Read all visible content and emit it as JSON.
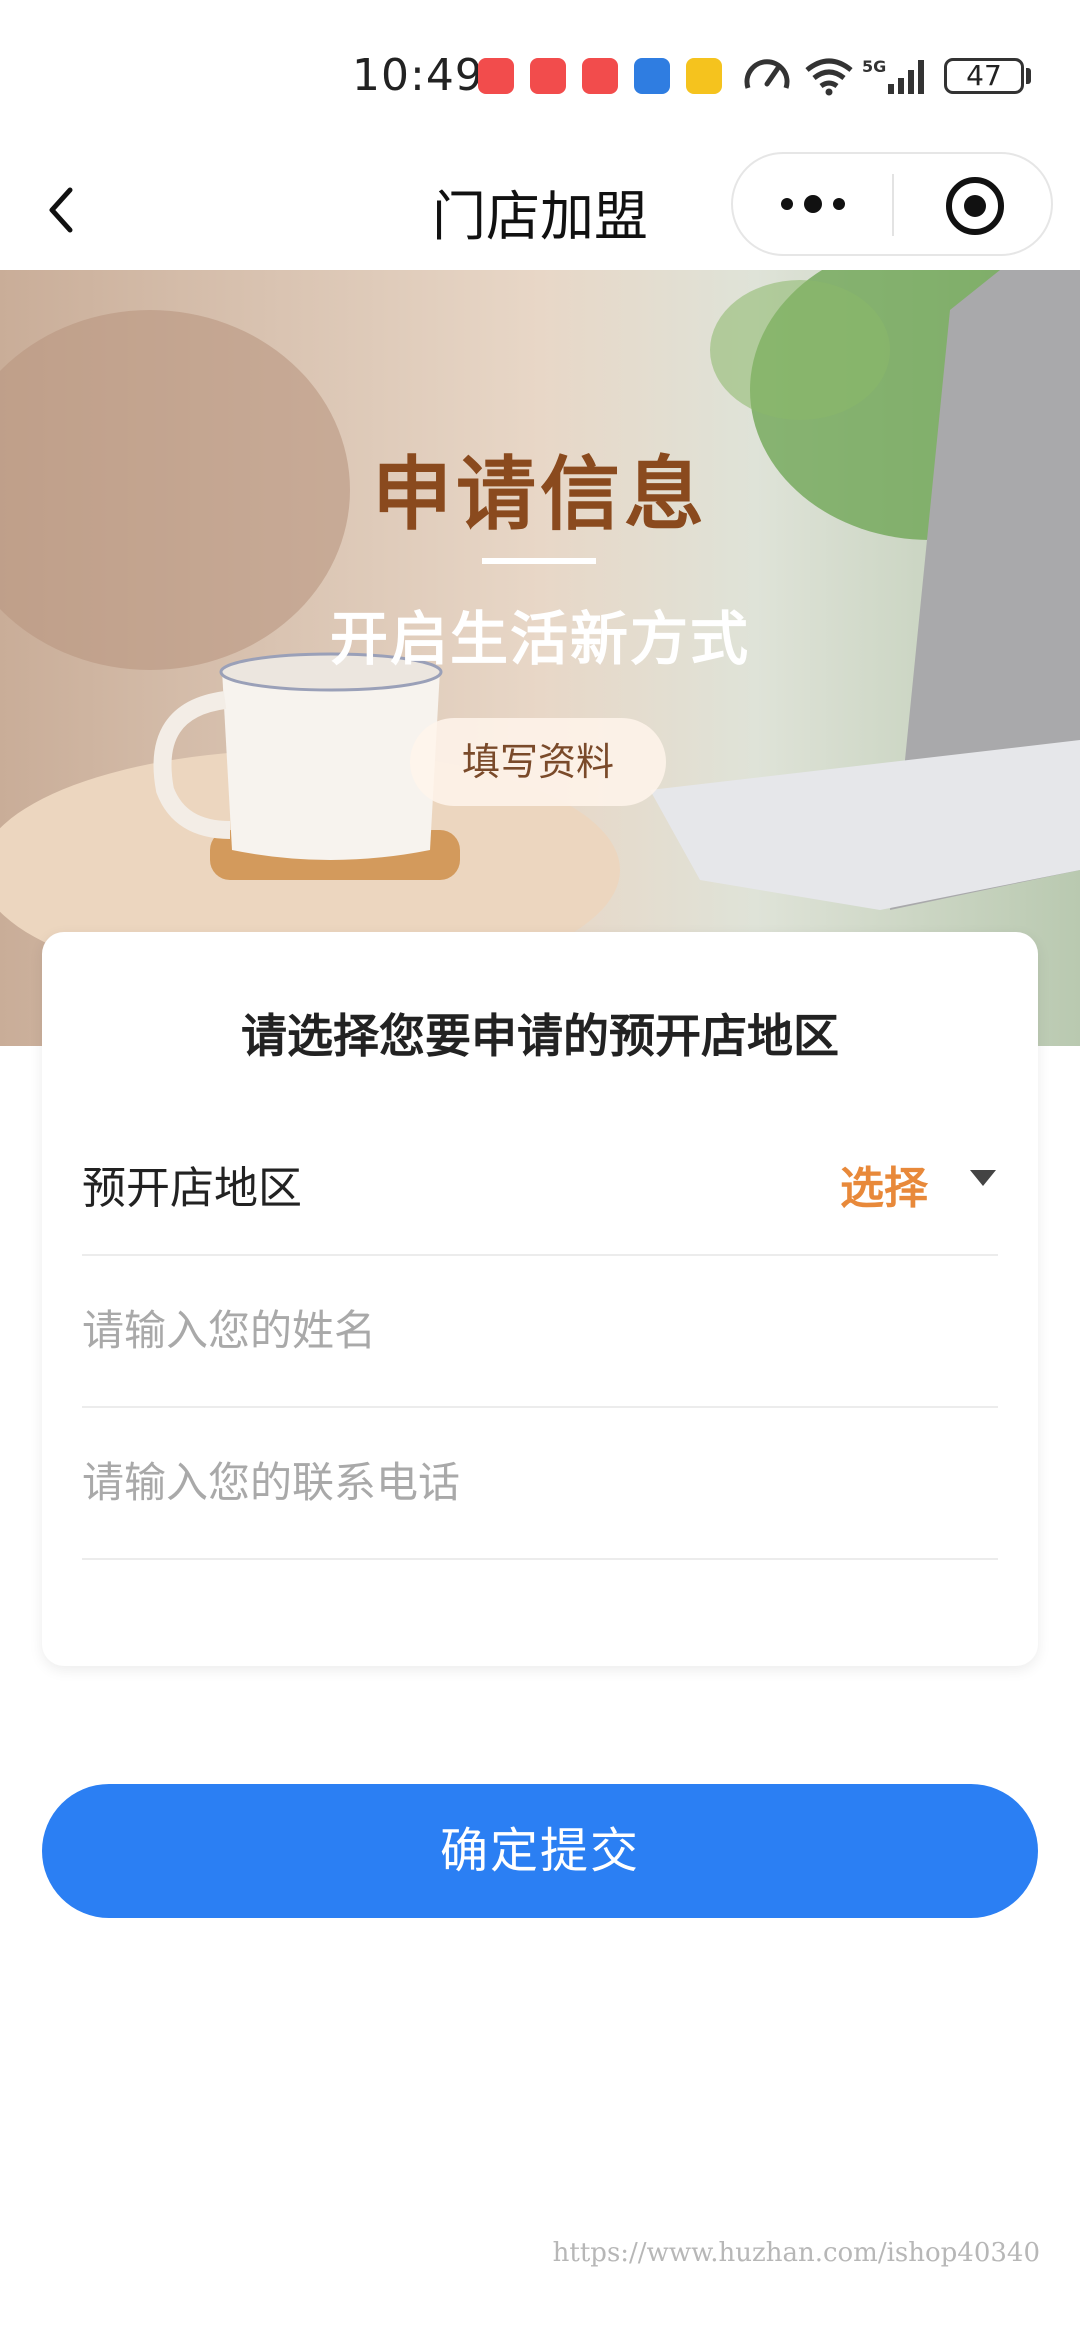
{
  "status_bar": {
    "time": "10:49",
    "battery": "47",
    "icons": [
      "huawei-app-icon",
      "huawei-app-icon",
      "huawei-app-icon",
      "shield-app-icon",
      "lottery-app-icon",
      "speed-icon",
      "wifi-icon",
      "5g-signal-icon",
      "battery-icon"
    ]
  },
  "navbar": {
    "title": "门店加盟",
    "back_icon": "chevron-left-icon",
    "more_icon": "more-dots-icon",
    "close_icon": "target-icon"
  },
  "banner": {
    "title": "申请信息",
    "subtitle": "开启生活新方式",
    "button_label": "填写资料"
  },
  "form": {
    "heading": "请选择您要申请的预开店地区",
    "region_label": "预开店地区",
    "region_select": "选择",
    "name_placeholder": "请输入您的姓名",
    "phone_placeholder": "请输入您的联系电话"
  },
  "submit_label": "确定提交",
  "watermark": "https://www.huzhan.com/ishop40340",
  "colors": {
    "accent": "#2b7ff3",
    "select": "#e8893a",
    "banner_title": "#8a4a1e"
  }
}
